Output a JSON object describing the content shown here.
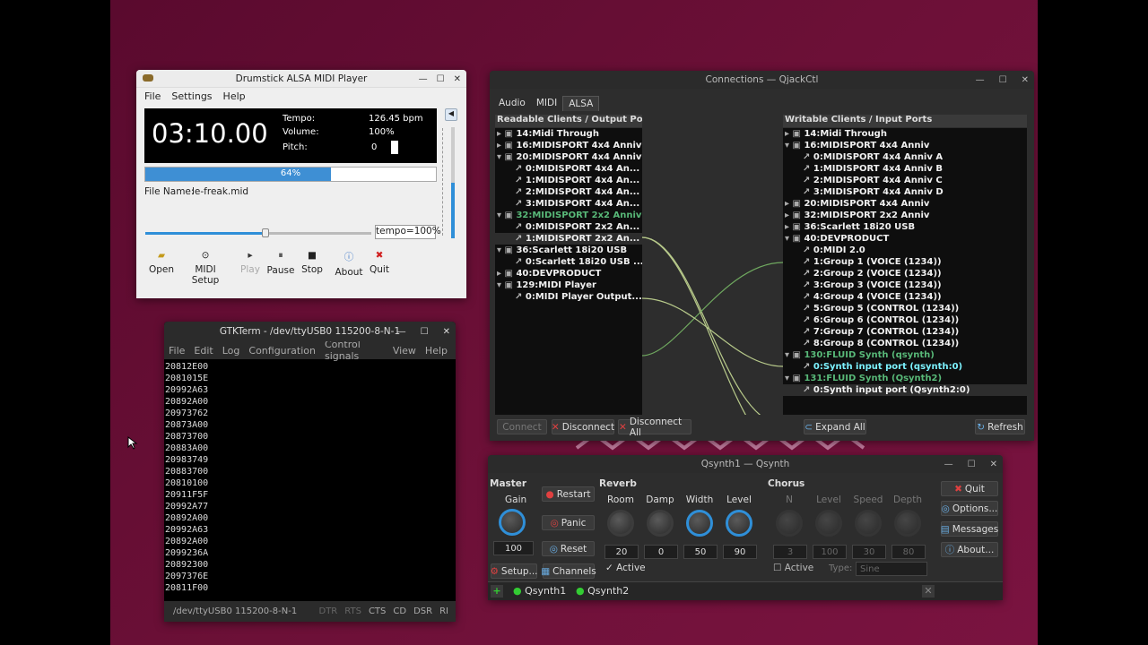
{
  "player": {
    "title": "Drumstick ALSA MIDI Player",
    "menu": [
      "File",
      "Settings",
      "Help"
    ],
    "time": "03:10.00",
    "tempo_label": "Tempo:",
    "tempo_value": "126.45 bpm",
    "volume_label": "Volume:",
    "volume_value": "100%",
    "pitch_label": "Pitch:",
    "pitch_value": "0",
    "progress_text": "64%",
    "progress": 0.64,
    "file_label": "File Name:",
    "file_value": "le-freak.mid",
    "tempo_box": "tempo=100%",
    "tools": [
      "Open",
      "MIDI Setup",
      "Play",
      "Pause",
      "Stop",
      "About",
      "Quit"
    ]
  },
  "gtkterm": {
    "title": "GTKTerm - /dev/ttyUSB0  115200-8-N-1",
    "menu": [
      "File",
      "Edit",
      "Log",
      "Configuration",
      "Control signals",
      "View",
      "Help"
    ],
    "lines": [
      "20812E00",
      "2081015E",
      "20992A63",
      "20892A00",
      "20973762",
      "20873A00",
      "20873700",
      "20883A00",
      "20983749",
      "20883700",
      "20810100",
      "20911F5F",
      "20992A77",
      "20892A00",
      "20992A63",
      "20892A00",
      "2099236A",
      "20892300",
      "2097376E",
      "20811F00"
    ],
    "status_port": "/dev/ttyUSB0  115200-8-N-1",
    "signals": [
      "DTR",
      "RTS",
      "CTS",
      "CD",
      "DSR",
      "RI"
    ]
  },
  "qjack": {
    "title": "Connections — QjackCtl",
    "tabs": [
      "Audio",
      "MIDI",
      "ALSA"
    ],
    "left_header": "Readable Clients / Output Ports",
    "right_header": "Writable Clients / Input Ports",
    "left": [
      {
        "t": "14:Midi Through",
        "l": 0,
        "x": "▸"
      },
      {
        "t": "16:MIDISPORT 4x4 Anniv",
        "l": 0,
        "x": "▸"
      },
      {
        "t": "20:MIDISPORT 4x4 Anniv",
        "l": 0,
        "x": "▾"
      },
      {
        "t": "0:MIDISPORT 4x4 An...",
        "l": 1
      },
      {
        "t": "1:MIDISPORT 4x4 An...",
        "l": 1
      },
      {
        "t": "2:MIDISPORT 4x4 An...",
        "l": 1
      },
      {
        "t": "3:MIDISPORT 4x4 An...",
        "l": 1
      },
      {
        "t": "32:MIDISPORT 2x2 Anniv",
        "l": 0,
        "x": "▾",
        "g": 1
      },
      {
        "t": "0:MIDISPORT 2x2 An...",
        "l": 1
      },
      {
        "t": "1:MIDISPORT 2x2 An...",
        "l": 1,
        "s": 1
      },
      {
        "t": "36:Scarlett 18i20 USB",
        "l": 0,
        "x": "▾"
      },
      {
        "t": "0:Scarlett 18i20 USB ...",
        "l": 1
      },
      {
        "t": "40:DEVPRODUCT",
        "l": 0,
        "x": "▸"
      },
      {
        "t": "129:MIDI Player",
        "l": 0,
        "x": "▾"
      },
      {
        "t": "0:MIDI Player Output...",
        "l": 1
      }
    ],
    "right": [
      {
        "t": "14:Midi Through",
        "l": 0,
        "x": "▸"
      },
      {
        "t": "16:MIDISPORT 4x4 Anniv",
        "l": 0,
        "x": "▾"
      },
      {
        "t": "0:MIDISPORT 4x4 Anniv A",
        "l": 1
      },
      {
        "t": "1:MIDISPORT 4x4 Anniv B",
        "l": 1
      },
      {
        "t": "2:MIDISPORT 4x4 Anniv C",
        "l": 1
      },
      {
        "t": "3:MIDISPORT 4x4 Anniv D",
        "l": 1
      },
      {
        "t": "20:MIDISPORT 4x4 Anniv",
        "l": 0,
        "x": "▸"
      },
      {
        "t": "32:MIDISPORT 2x2 Anniv",
        "l": 0,
        "x": "▸"
      },
      {
        "t": "36:Scarlett 18i20 USB",
        "l": 0,
        "x": "▸"
      },
      {
        "t": "40:DEVPRODUCT",
        "l": 0,
        "x": "▾"
      },
      {
        "t": "0:MIDI 2.0",
        "l": 1
      },
      {
        "t": "1:Group 1 (VOICE (1234))",
        "l": 1
      },
      {
        "t": "2:Group 2 (VOICE (1234))",
        "l": 1
      },
      {
        "t": "3:Group 3 (VOICE (1234))",
        "l": 1
      },
      {
        "t": "4:Group 4 (VOICE (1234))",
        "l": 1
      },
      {
        "t": "5:Group 5 (CONTROL (1234))",
        "l": 1
      },
      {
        "t": "6:Group 6 (CONTROL (1234))",
        "l": 1
      },
      {
        "t": "7:Group 7 (CONTROL (1234))",
        "l": 1
      },
      {
        "t": "8:Group 8 (CONTROL (1234))",
        "l": 1
      },
      {
        "t": "130:FLUID Synth (qsynth)",
        "l": 0,
        "x": "▾",
        "g": 1
      },
      {
        "t": "0:Synth input port (qsynth:0)",
        "l": 1,
        "c": 1
      },
      {
        "t": "131:FLUID Synth (Qsynth2)",
        "l": 0,
        "x": "▾",
        "g": 1
      },
      {
        "t": "0:Synth input port (Qsynth2:0)",
        "l": 1,
        "s": 1
      }
    ],
    "buttons": {
      "connect": "Connect",
      "disconnect": "Disconnect",
      "disconnect_all": "Disconnect All",
      "expand_all": "Expand All",
      "refresh": "Refresh"
    }
  },
  "qsynth": {
    "title": "Qsynth1 — Qsynth",
    "master": "Master",
    "gain": "Gain",
    "gain_value": "100",
    "restart": "Restart",
    "panic": "Panic",
    "reset": "Reset",
    "setup": "Setup...",
    "channels": "Channels",
    "reverb": "Reverb",
    "reverb_labels": [
      "Room",
      "Damp",
      "Width",
      "Level"
    ],
    "reverb_values": [
      "20",
      "0",
      "50",
      "90"
    ],
    "reverb_active": "Active",
    "chorus": "Chorus",
    "chorus_labels": [
      "N",
      "Level",
      "Speed",
      "Depth"
    ],
    "chorus_values": [
      "3",
      "100",
      "30",
      "80"
    ],
    "chorus_active": "Active",
    "chorus_type_label": "Type:",
    "chorus_type": "Sine",
    "quit": "Quit",
    "options": "Options...",
    "messages": "Messages",
    "about": "About...",
    "tabs": [
      "Qsynth1",
      "Qsynth2"
    ]
  }
}
